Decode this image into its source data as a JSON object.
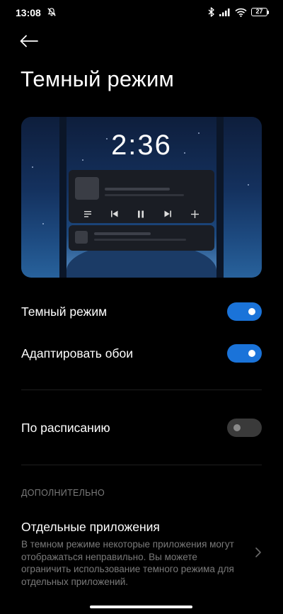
{
  "status_bar": {
    "time": "13:08",
    "battery": "27"
  },
  "header": {
    "title": "Темный режим"
  },
  "preview": {
    "clock": "2:36"
  },
  "settings": {
    "dark_mode": {
      "label": "Темный режим",
      "enabled": true
    },
    "adapt_wallpaper": {
      "label": "Адаптировать обои",
      "enabled": true
    },
    "schedule": {
      "label": "По расписанию",
      "enabled": false
    }
  },
  "additional": {
    "section_label": "ДОПОЛНИТЕЛЬНО",
    "individual_apps": {
      "title": "Отдельные приложения",
      "description": "В темном режиме некоторые приложения могут отображаться неправильно. Вы можете ограничить использование темного режима для отдельных приложений."
    }
  },
  "colors": {
    "accent": "#1a73d9",
    "background": "#000000",
    "secondary_text": "#7a7a7a"
  },
  "icons": {
    "back": "arrow-left-icon",
    "mute": "bell-off-icon",
    "bluetooth": "bluetooth-icon",
    "signal": "signal-icon",
    "wifi": "wifi-icon",
    "chevron": "chevron-right-icon"
  }
}
